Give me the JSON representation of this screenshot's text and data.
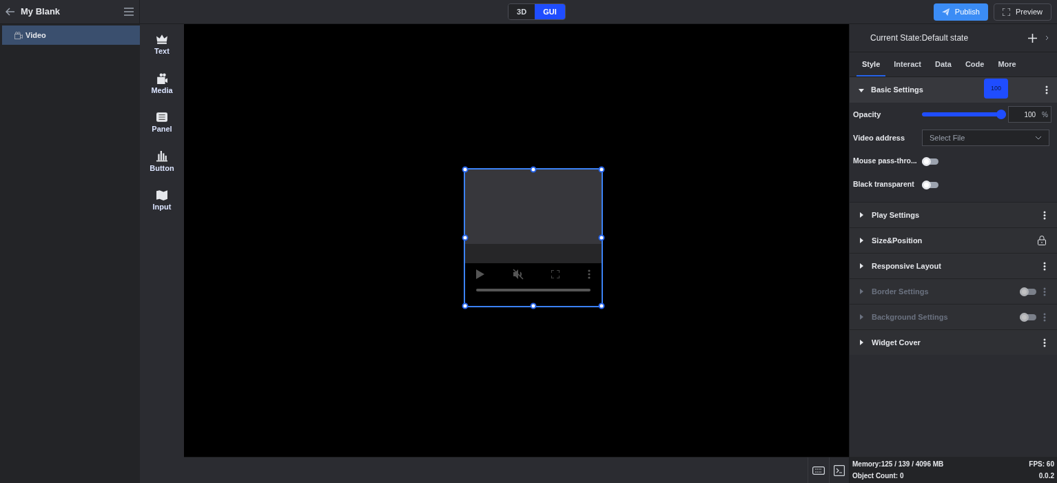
{
  "project": {
    "title": "My Blank"
  },
  "mode_toggle": [
    {
      "label": "3D",
      "selected": false
    },
    {
      "label": "GUI",
      "selected": true
    }
  ],
  "actions": {
    "publish": "Publish",
    "preview": "Preview"
  },
  "layers": [
    {
      "label": "Video",
      "selected": true
    }
  ],
  "widgets": [
    {
      "label": "Text",
      "kind": "text"
    },
    {
      "label": "Media",
      "kind": "media"
    },
    {
      "label": "Panel",
      "kind": "panel"
    },
    {
      "label": "Button",
      "kind": "button"
    },
    {
      "label": "Input",
      "kind": "input"
    }
  ],
  "properties": {
    "state_label": "Current State:Default state",
    "tabs": [
      {
        "label": "Style",
        "selected": true
      },
      {
        "label": "Interact",
        "selected": false
      },
      {
        "label": "Data",
        "selected": false
      },
      {
        "label": "Code",
        "selected": false
      },
      {
        "label": "More",
        "selected": false
      }
    ],
    "basic_settings": {
      "title": "Basic Settings",
      "expanded": true,
      "tooltip": "100",
      "opacity": {
        "label": "Opacity",
        "level": 1,
        "value": "100",
        "unit": "%"
      },
      "video_address": {
        "label": "Video address",
        "placeholder": "Select File"
      },
      "toggles": [
        {
          "label": "Mouse pass-thro...",
          "on": false
        },
        {
          "label": "Black transparent",
          "on": false
        }
      ]
    },
    "sections": [
      {
        "title": "Play Settings",
        "kind": "menu",
        "expanded": false,
        "disabled": false
      },
      {
        "title": "Size&Position",
        "kind": "lock",
        "expanded": false,
        "disabled": false
      },
      {
        "title": "Responsive Layout",
        "kind": "menu",
        "expanded": false,
        "disabled": false
      },
      {
        "title": "Border Settings",
        "kind": "switch",
        "expanded": false,
        "disabled": true,
        "on": false
      },
      {
        "title": "Background Settings",
        "kind": "switch",
        "expanded": false,
        "disabled": true,
        "on": false
      },
      {
        "title": "Widget Cover",
        "kind": "menu",
        "expanded": false,
        "disabled": false
      }
    ]
  },
  "status_bar": {
    "memory": "Memory:125 / 139 / 4096 MB",
    "fps": "FPS: 60",
    "object_count": "Object Count: 0",
    "version": "0.0.2"
  }
}
